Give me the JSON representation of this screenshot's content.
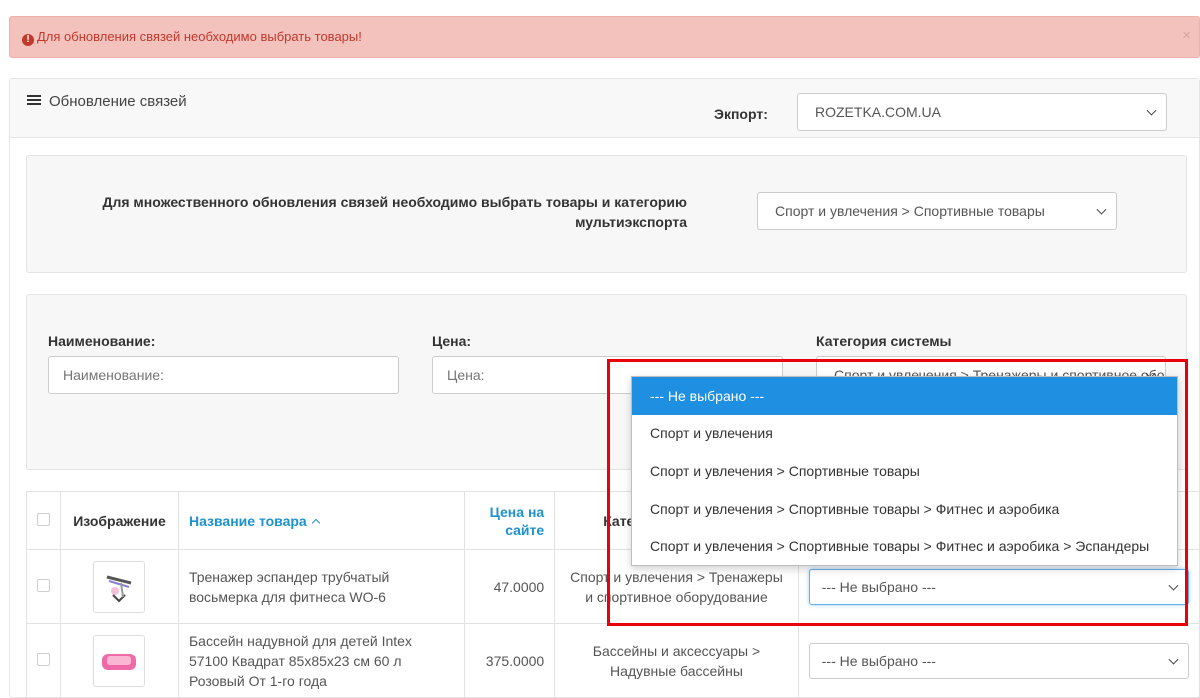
{
  "alert": {
    "message": "Для обновления связей необходимо выбрать товары!",
    "close": "×"
  },
  "panel": {
    "title": "Обновление связей",
    "export_label": "Экпорт:",
    "export_value": "ROZETKA.COM.UA"
  },
  "bulk": {
    "instruction": "Для множественного обновления связей необходимо выбрать товары и категорию мультиэкспорта",
    "category_value": "Спорт и увлечения > Спортивные товары"
  },
  "filter": {
    "name_label": "Наименование:",
    "name_placeholder": "Наименование:",
    "price_label": "Цена:",
    "price_placeholder": "Цена:",
    "system_category_label": "Категория системы",
    "system_category_value": "Спорт и увлечения > Тренажеры и спортивное оборудование"
  },
  "dropdown": {
    "options": [
      "--- Не выбрано ---",
      "Спорт и увлечения",
      "Спорт и увлечения > Спортивные товары",
      "Спорт и увлечения > Спортивные товары > Фитнес и аэробика",
      "Спорт и увлечения > Спортивные товары > Фитнес и аэробика > Эспандеры"
    ],
    "selected_index": 0
  },
  "table": {
    "headers": {
      "image": "Изображение",
      "name": "Название товара",
      "price": "Цена на сайте",
      "category": "Категория"
    },
    "rows": [
      {
        "name": "Тренажер эспандер трубчатый восьмерка для фитнеса WO-6",
        "price": "47.0000",
        "category": "Спорт и увлечения > Тренажеры и спортивное оборудование",
        "select": "--- Не выбрано ---"
      },
      {
        "name": "Бассейн надувной для детей Intex 57100 Квадрат 85х85х23 см 60 л Розовый От 1-го года",
        "price": "375.0000",
        "category": "Бассейны и аксессуары > Надувные бассейны",
        "select": "--- Не выбрано ---"
      }
    ]
  },
  "colors": {
    "alert_bg": "#f4c2bd",
    "alert_text": "#c0392b",
    "link": "#1e91cf",
    "active_option": "#1e8fe1",
    "highlight": "#e8000b"
  }
}
